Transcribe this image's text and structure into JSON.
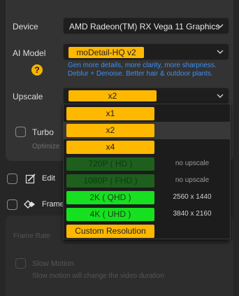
{
  "device": {
    "label": "Device",
    "value": "AMD Radeon(TM) RX Vega 11 Graphics"
  },
  "ai_model": {
    "label": "AI Model",
    "value": "moDetail-HQ  v2",
    "description_line1": "Gen more details, more clarity, more sharpness.",
    "description_line2": "Deblur + Denoise. Better hair & outdoor plants.",
    "help_glyph": "?"
  },
  "upscale": {
    "label": "Upscale",
    "value": "x2",
    "options": [
      {
        "label": "x1",
        "resolution": "",
        "style": "yellow"
      },
      {
        "label": "x2",
        "resolution": "",
        "style": "yellow"
      },
      {
        "label": "x4",
        "resolution": "",
        "style": "yellow"
      },
      {
        "label": "720P ( HD )",
        "resolution": "no upscale",
        "style": "darkgreen"
      },
      {
        "label": "1080P ( FHD )",
        "resolution": "no upscale",
        "style": "darkgreen"
      },
      {
        "label": "2K ( QHD )",
        "resolution": "2560 x 1440",
        "style": "green"
      },
      {
        "label": "4K ( UHD )",
        "resolution": "3840 x 2160",
        "style": "green"
      },
      {
        "label": "Custom Resolution",
        "resolution": "",
        "style": "yellow"
      }
    ]
  },
  "turbo": {
    "label": "Turbo",
    "sub": "Optimize"
  },
  "edit": {
    "label": "Edit"
  },
  "frame": {
    "label": "Frame"
  },
  "frame_rate": {
    "label": "Frame Rate"
  },
  "slow_motion": {
    "label": "Slow Motion",
    "sub": "Slow motion will change the video duration"
  },
  "colors": {
    "accent_yellow": "#ffb800",
    "accent_green": "#17e020",
    "dim_green": "#1e5f1e",
    "link_blue": "#3f8ef0"
  }
}
